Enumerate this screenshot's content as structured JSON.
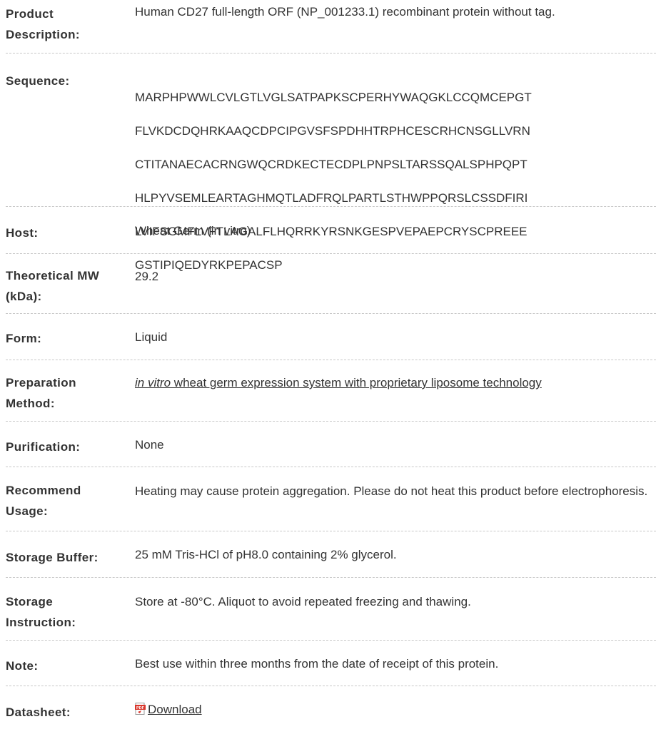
{
  "rows": [
    {
      "label": "Product Description:",
      "value": "Human CD27 full-length ORF (NP_001233.1) recombinant protein without tag."
    },
    {
      "label": "Sequence:",
      "value": "MARPHPWWLCVLGTLVGLSATPAPKSCPERHYWAQGKLCCQMCEPGTFLVKDCDQHRKAAQCDPCIPGVSFSPDHHTRPHCESCRHCNSGLLVRNCTITANAECACRNGWQCRDKECTECDPLPNPSLTARSSQALSPHPQPTHLPYVSEMLEARTAGHMQTLADFRQLPARTLSTHWPPQRSLCSSDFIRILVIFSGMFLVFTLAGALFLHQRRKYRSNKGESPVEPAEPCRYSCPREEEGSTIPIQEDYRKPEPACSP"
    },
    {
      "label": "Host:",
      "value": "Wheat Germ (in vitro)"
    },
    {
      "label": "Theoretical MW (kDa):",
      "value": "29.2"
    },
    {
      "label": "Form:",
      "value": "Liquid"
    },
    {
      "label": "Preparation Method:",
      "link_italic": "in vitro",
      "link_rest": " wheat germ expression system with proprietary liposome technology"
    },
    {
      "label": "Purification:",
      "value": "None"
    },
    {
      "label": "Recommend Usage:",
      "value": "Heating may cause protein aggregation. Please do not heat this product before electrophoresis."
    },
    {
      "label": "Storage Buffer:",
      "value": "25 mM Tris-HCl of pH8.0 containing 2% glycerol."
    },
    {
      "label": "Storage Instruction:",
      "value": "Store at -80°C. Aliquot to avoid repeated freezing and thawing."
    },
    {
      "label": "Note:",
      "value": "Best use within three months from the date of receipt of this protein."
    },
    {
      "label": "Datasheet:",
      "link": "Download",
      "icon": "pdf-icon"
    }
  ],
  "sequence_lines": [
    "MARPHPWWLCVLGTLVGLSATPAPKSCPERHYWAQGKLCCQMCEPGT",
    "FLVKDCDQHRKAAQCDPCIPGVSFSPDHHTRPHCESCRHCNSGLLVRN",
    "CTITANAECACRNGWQCRDKECTECDPLPNPSLTARSSQALSPHPQPT",
    "HLPYVSEMLEARTAGHMQTLADFRQLPARTLSTHWPPQRSLCSSDFIRI",
    "LVIFSGMFLVFTLAGALFLHQRRKYRSNKGESPVEPAEPCRYSCPREEE",
    "GSTIPIQEDYRKPEPACSP"
  ],
  "label_lines": {
    "product_description": [
      "Product",
      "Description:"
    ],
    "theoretical_mw": [
      "Theoretical MW",
      "(kDa):"
    ],
    "preparation_method": [
      "Preparation",
      "Method:"
    ],
    "recommend_usage": [
      "Recommend",
      "Usage:"
    ],
    "storage_instruction": [
      "Storage",
      "Instruction:"
    ]
  },
  "colors": {
    "text": "#333333",
    "divider": "#c8c8c8",
    "pdf_icon": "#d9352b"
  }
}
